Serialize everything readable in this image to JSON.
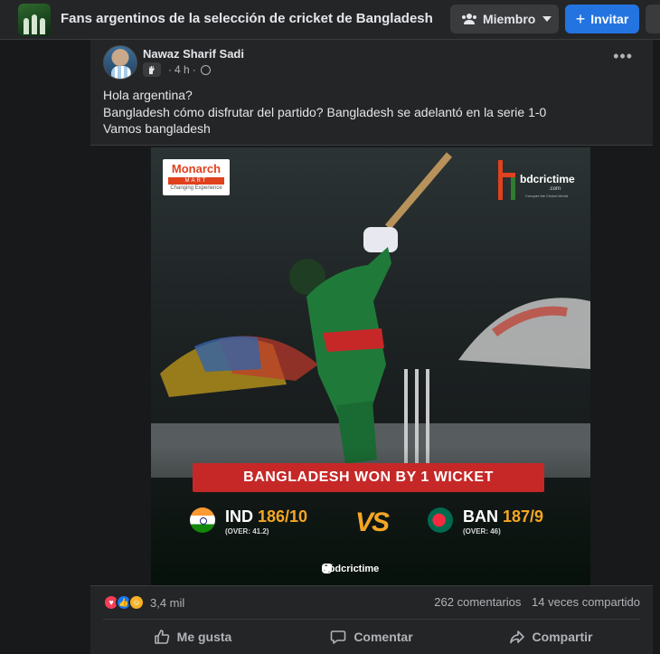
{
  "topbar": {
    "group_name": "Fans argentinos de la selección de cricket de Bangladesh",
    "member_button": "Miembro",
    "invite_button": "Invitar"
  },
  "post": {
    "author": "Nawaz Sharif Sadi",
    "time": "4 h",
    "privacy_icon": "globe-icon",
    "text_lines": [
      "Hola argentina?",
      "Bangladesh cómo disfrutar del partido? Bangladesh se adelantó en la serie 1-0",
      "Vamos bangladesh"
    ],
    "image": {
      "sponsor": {
        "name": "Monarch",
        "mart": "MART",
        "tagline": "Changing Experience"
      },
      "brand": {
        "name": "bdcrictime",
        "sub": ".com",
        "tagline": "Conquer the Cricket World"
      },
      "banner": "BANGLADESH WON BY 1 WICKET",
      "team1": {
        "code": "IND",
        "score": "186/10",
        "overs": "(OVER: 41.2)"
      },
      "vs": "VS",
      "team2": {
        "code": "BAN",
        "score": "187/9",
        "overs": "(OVER: 46)"
      },
      "social_handle": "bdcrictime"
    },
    "reactions": {
      "icons": [
        "love-icon",
        "like-icon",
        "care-icon"
      ],
      "count": "3,4 mil"
    },
    "comments": "262 comentarios",
    "shares": "14 veces compartido",
    "actions": {
      "like": "Me gusta",
      "comment": "Comentar",
      "share": "Compartir"
    }
  },
  "colors": {
    "background": "#18191a",
    "card": "#242526",
    "accent": "#2374e1",
    "banner_red": "#c62828",
    "score_orange": "#f5a623"
  }
}
